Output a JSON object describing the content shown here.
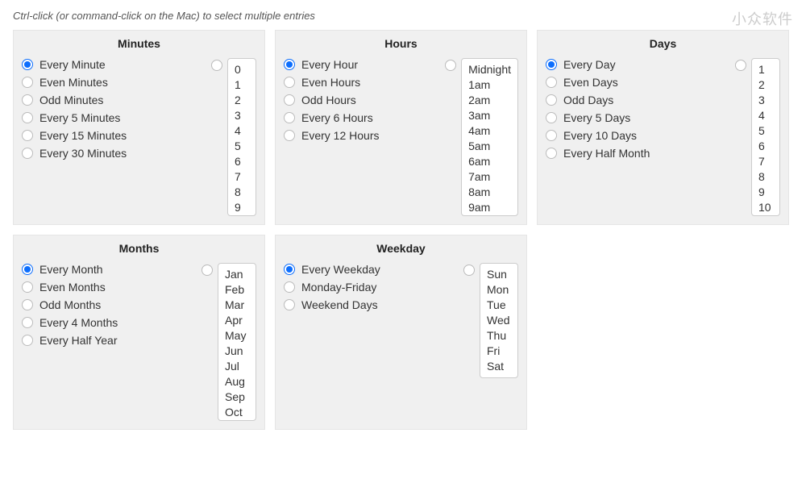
{
  "instruction": "Ctrl-click (or command-click on the Mac) to select multiple entries",
  "watermark": "小众软件",
  "panels": {
    "minutes": {
      "title": "Minutes",
      "options": [
        "Every Minute",
        "Even Minutes",
        "Odd Minutes",
        "Every 5 Minutes",
        "Every 15 Minutes",
        "Every 30 Minutes"
      ],
      "selected": 0,
      "list": [
        "0",
        "1",
        "2",
        "3",
        "4",
        "5",
        "6",
        "7",
        "8",
        "9"
      ]
    },
    "hours": {
      "title": "Hours",
      "options": [
        "Every Hour",
        "Even Hours",
        "Odd Hours",
        "Every 6 Hours",
        "Every 12 Hours"
      ],
      "selected": 0,
      "list": [
        "Midnight",
        "1am",
        "2am",
        "3am",
        "4am",
        "5am",
        "6am",
        "7am",
        "8am",
        "9am"
      ]
    },
    "days": {
      "title": "Days",
      "options": [
        "Every Day",
        "Even Days",
        "Odd Days",
        "Every 5 Days",
        "Every 10 Days",
        "Every Half Month"
      ],
      "selected": 0,
      "list": [
        "1",
        "2",
        "3",
        "4",
        "5",
        "6",
        "7",
        "8",
        "9",
        "10"
      ]
    },
    "months": {
      "title": "Months",
      "options": [
        "Every Month",
        "Even Months",
        "Odd Months",
        "Every 4 Months",
        "Every Half Year"
      ],
      "selected": 0,
      "list": [
        "Jan",
        "Feb",
        "Mar",
        "Apr",
        "May",
        "Jun",
        "Jul",
        "Aug",
        "Sep",
        "Oct"
      ]
    },
    "weekday": {
      "title": "Weekday",
      "options": [
        "Every Weekday",
        "Monday-Friday",
        "Weekend Days"
      ],
      "selected": 0,
      "list": [
        "Sun",
        "Mon",
        "Tue",
        "Wed",
        "Thu",
        "Fri",
        "Sat"
      ]
    }
  }
}
